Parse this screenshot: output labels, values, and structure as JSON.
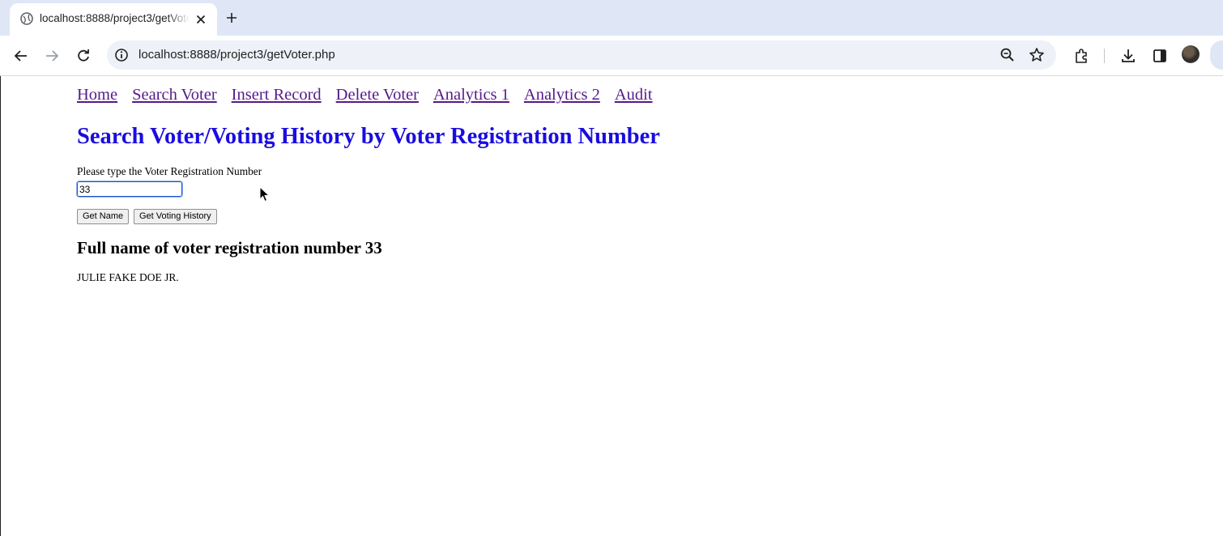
{
  "browser": {
    "tab": {
      "title": "localhost:8888/project3/getVoter.php",
      "close_icon": "close-icon",
      "favicon": "globe-icon"
    },
    "new_tab_icon": "plus-icon",
    "address_bar": {
      "url": "localhost:8888/project3/getVoter.php",
      "info_icon": "info-icon",
      "zoom_icon": "zoom-icon",
      "bookmark_icon": "star-icon"
    },
    "toolbar_icons": [
      "back-icon",
      "forward-icon",
      "reload-icon",
      "extensions-icon",
      "download-icon",
      "side-panel-icon",
      "profile-avatar"
    ]
  },
  "nav": {
    "links": [
      "Home",
      "Search Voter",
      "Insert Record",
      "Delete Voter",
      "Analytics 1",
      "Analytics 2",
      "Audit"
    ]
  },
  "page": {
    "title": "Search Voter/Voting History by Voter Registration Number",
    "input_label": "Please type the Voter Registration Number",
    "input_value": "33",
    "buttons": {
      "get_name": "Get Name",
      "get_history": "Get Voting History"
    },
    "result_heading": "Full name of voter registration number 33",
    "result_text": "JULIE FAKE DOE JR."
  },
  "colors": {
    "title": "#1a0dde",
    "visited_link": "#551a8b",
    "tabbar_bg": "#dfe7f6",
    "omnibox_bg": "#eef1f7"
  }
}
